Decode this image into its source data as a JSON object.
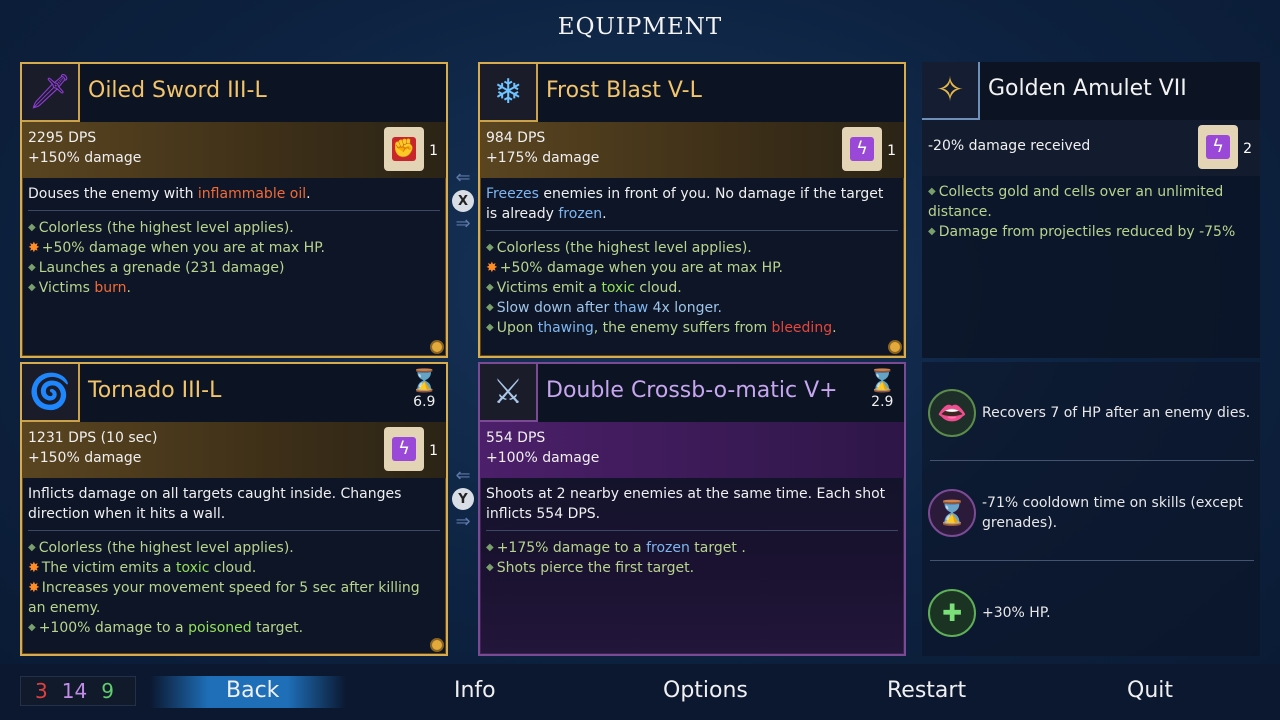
{
  "title": "EQUIPMENT",
  "weapon1": {
    "name": "Oiled Sword III-L",
    "dps": "2295 DPS",
    "bonus": "+150% damage",
    "scroll_count": "1",
    "desc_pre": "Douses the enemy with ",
    "desc_hl": "inflammable oil",
    "desc_post": ".",
    "b1": "Colorless (the highest level applies).",
    "b2": "+50% damage when you are at max HP.",
    "b3": "Launches a grenade (231 damage)",
    "b4_pre": "Victims ",
    "b4_hl": "burn",
    "b4_post": "."
  },
  "weapon2": {
    "name": "Frost Blast V-L",
    "dps": "984 DPS",
    "bonus": "+175% damage",
    "scroll_count": "1",
    "desc_hl1": "Freezes",
    "desc_mid": " enemies in front of you. No damage if the target is already ",
    "desc_hl2": "frozen",
    "desc_post": ".",
    "b1": "Colorless (the highest level applies).",
    "b2": "+50% damage when you are at max HP.",
    "b3_pre": "Victims emit a ",
    "b3_hl": "toxic",
    "b3_post": " cloud.",
    "b4_pre": "Slow down after ",
    "b4_hl": "thaw",
    "b4_post": " 4x longer.",
    "b5_pre": "Upon ",
    "b5_hl1": "thawing",
    "b5_mid": ", the enemy suffers from ",
    "b5_hl2": "bleeding",
    "b5_post": "."
  },
  "amulet": {
    "name": "Golden Amulet VII",
    "stat": "-20% damage received",
    "scroll_count": "2",
    "b1": "Collects gold and cells over an unlimited distance.",
    "b2": "Damage from projectiles reduced by -75%"
  },
  "skill1": {
    "name": "Tornado III-L",
    "cooldown": "6.9",
    "dps": "1231 DPS (10 sec)",
    "bonus": "+150% damage",
    "scroll_count": "1",
    "desc": "Inflicts damage on all targets caught inside. Changes direction when it hits a wall.",
    "b1": "Colorless (the highest level applies).",
    "b2_pre": "The victim emits a ",
    "b2_hl": "toxic",
    "b2_post": " cloud.",
    "b3": "Increases your movement speed for 5 sec after killing an enemy.",
    "b4_pre": "+100% damage to a ",
    "b4_hl": "poisoned",
    "b4_post": " target."
  },
  "skill2": {
    "name": "Double Crossb-o-matic V+",
    "cooldown": "2.9",
    "dps": "554 DPS",
    "bonus": "+100% damage",
    "desc": "Shoots at 2 nearby enemies at the same time. Each shot inflicts 554 DPS.",
    "b1_pre": "+175% damage to a ",
    "b1_hl": "frozen",
    "b1_post": " target .",
    "b2": "Shots pierce the first target."
  },
  "swap_keys": {
    "top": "X",
    "bottom": "Y"
  },
  "mutations": [
    {
      "text": "Recovers 7 of HP after an enemy dies.",
      "icon": "fanged-mouth-icon"
    },
    {
      "text": "-71% cooldown time on skills (except grenades).",
      "icon": "hourglass-icon"
    },
    {
      "text": "+30% HP.",
      "icon": "health-plus-icon"
    }
  ],
  "scrolls": {
    "brutality": "3",
    "tactics": "14",
    "survival": "9"
  },
  "colors": {
    "brutality": "#e2403d",
    "tactics": "#c28ce8",
    "survival": "#5fcf6c",
    "gold": "#d8ac4c"
  },
  "menu": {
    "back": "Back",
    "info": "Info",
    "options": "Options",
    "restart": "Restart",
    "quit": "Quit"
  }
}
